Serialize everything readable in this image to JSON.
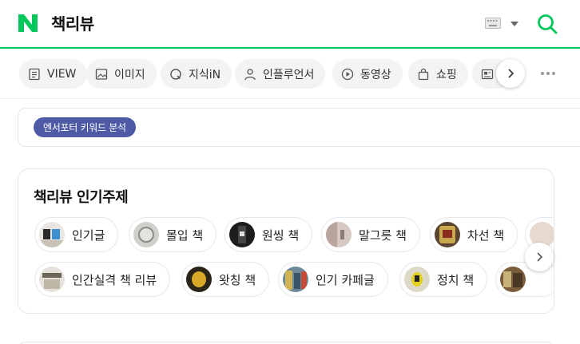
{
  "header": {
    "query": "책리뷰",
    "logo_letter": "N",
    "brand_color": "#03c75a",
    "keyboard_icon": "keyboard-icon",
    "search_icon": "search-icon"
  },
  "tabs": [
    {
      "label": "VIEW",
      "icon": "document-icon"
    },
    {
      "label": "이미지",
      "icon": "image-icon"
    },
    {
      "label": "지식iN",
      "icon": "q-icon"
    },
    {
      "label": "인플루언서",
      "icon": "person-icon"
    },
    {
      "label": "동영상",
      "icon": "play-icon"
    },
    {
      "label": "쇼핑",
      "icon": "bag-icon"
    },
    {
      "label": "",
      "icon": "news-icon"
    }
  ],
  "keyword_tool": {
    "label": "엔서포터 키워드 분석",
    "color": "#4e5aa6"
  },
  "popular_topics": {
    "title": "책리뷰 인기주제",
    "row1": [
      {
        "label": "인기글"
      },
      {
        "label": "몰입 책"
      },
      {
        "label": "원씽 책"
      },
      {
        "label": "말그릇 책"
      },
      {
        "label": "차선 책"
      }
    ],
    "row2": [
      {
        "label": "인간실격 책 리뷰"
      },
      {
        "label": "왓칭 책"
      },
      {
        "label": "인기 카페글"
      },
      {
        "label": "정치 책"
      }
    ]
  }
}
